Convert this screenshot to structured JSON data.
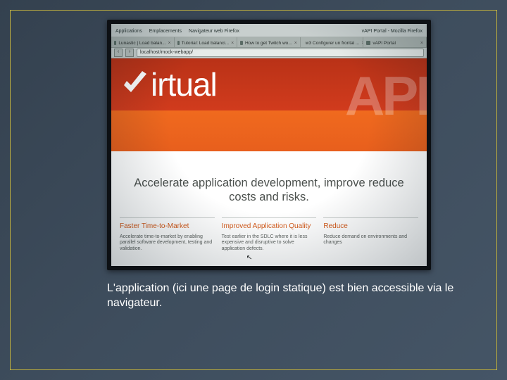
{
  "os_menu": {
    "applications": "Applications",
    "emplacements": "Emplacements",
    "browser": "Navigateur web Firefox",
    "window_title": "vAPI Portal - Mozilla Firefox"
  },
  "tabs": [
    {
      "label": "Lunastic | Load balan..."
    },
    {
      "label": "Tutorial: Load balanci..."
    },
    {
      "label": "How to get Twitch wo..."
    },
    {
      "label": "w3 Configurer un frontal ..."
    },
    {
      "label": "vAPI Portal"
    }
  ],
  "address_bar": {
    "url": "localhost/mock-webapp/"
  },
  "page": {
    "logo_word": "irtual",
    "logo_api": "API",
    "hero_headline": "Accelerate application development, improve reduce costs and risks.",
    "columns": [
      {
        "title": "Faster Time-to-Market",
        "body": "Accelerate time-to-market by enabling parallel software development, testing and validation."
      },
      {
        "title": "Improved Application Quality",
        "body": "Test earlier in the SDLC where it is less expensive and disruptive to solve application defects."
      },
      {
        "title": "Reduce",
        "body": "Reduce demand on environments and changes"
      }
    ]
  },
  "caption": "L'application (ici une page de login statique) est bien accessible via le navigateur."
}
